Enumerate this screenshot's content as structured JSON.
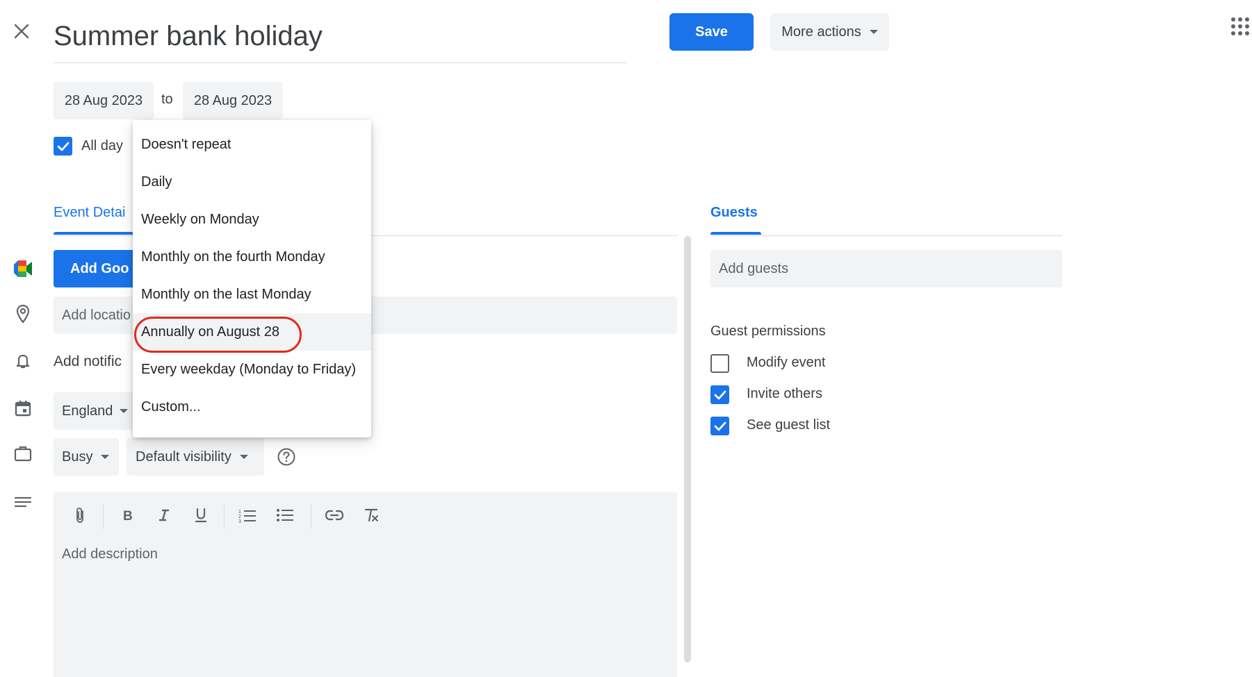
{
  "header": {
    "title": "Summer bank holiday",
    "save_label": "Save",
    "more_actions_label": "More actions"
  },
  "dates": {
    "start": "28 Aug 2023",
    "separator": "to",
    "end": "28 Aug 2023"
  },
  "all_day": {
    "label": "All day",
    "checked": true
  },
  "tabs": {
    "event_details": "Event Detai",
    "guests": "Guests"
  },
  "details": {
    "meet_button_label": "Add Goo",
    "location_placeholder": "Add locatio",
    "notification_text": "Add notific",
    "calendar_value": "England",
    "busy_value": "Busy",
    "visibility_value": "Default visibility",
    "description_placeholder": "Add description"
  },
  "repeat_menu": {
    "items": [
      "Doesn't repeat",
      "Daily",
      "Weekly on Monday",
      "Monthly on the fourth Monday",
      "Monthly on the last Monday",
      "Annually on August 28",
      "Every weekday (Monday to Friday)",
      "Custom..."
    ],
    "highlighted_index": 5
  },
  "guests": {
    "add_placeholder": "Add guests",
    "permissions_title": "Guest permissions",
    "permissions": [
      {
        "label": "Modify event",
        "checked": false
      },
      {
        "label": "Invite others",
        "checked": true
      },
      {
        "label": "See guest list",
        "checked": true
      }
    ]
  },
  "colors": {
    "accent": "#1a73e8",
    "field_bg": "#f1f3f4",
    "highlight_ring": "#e3281c"
  }
}
